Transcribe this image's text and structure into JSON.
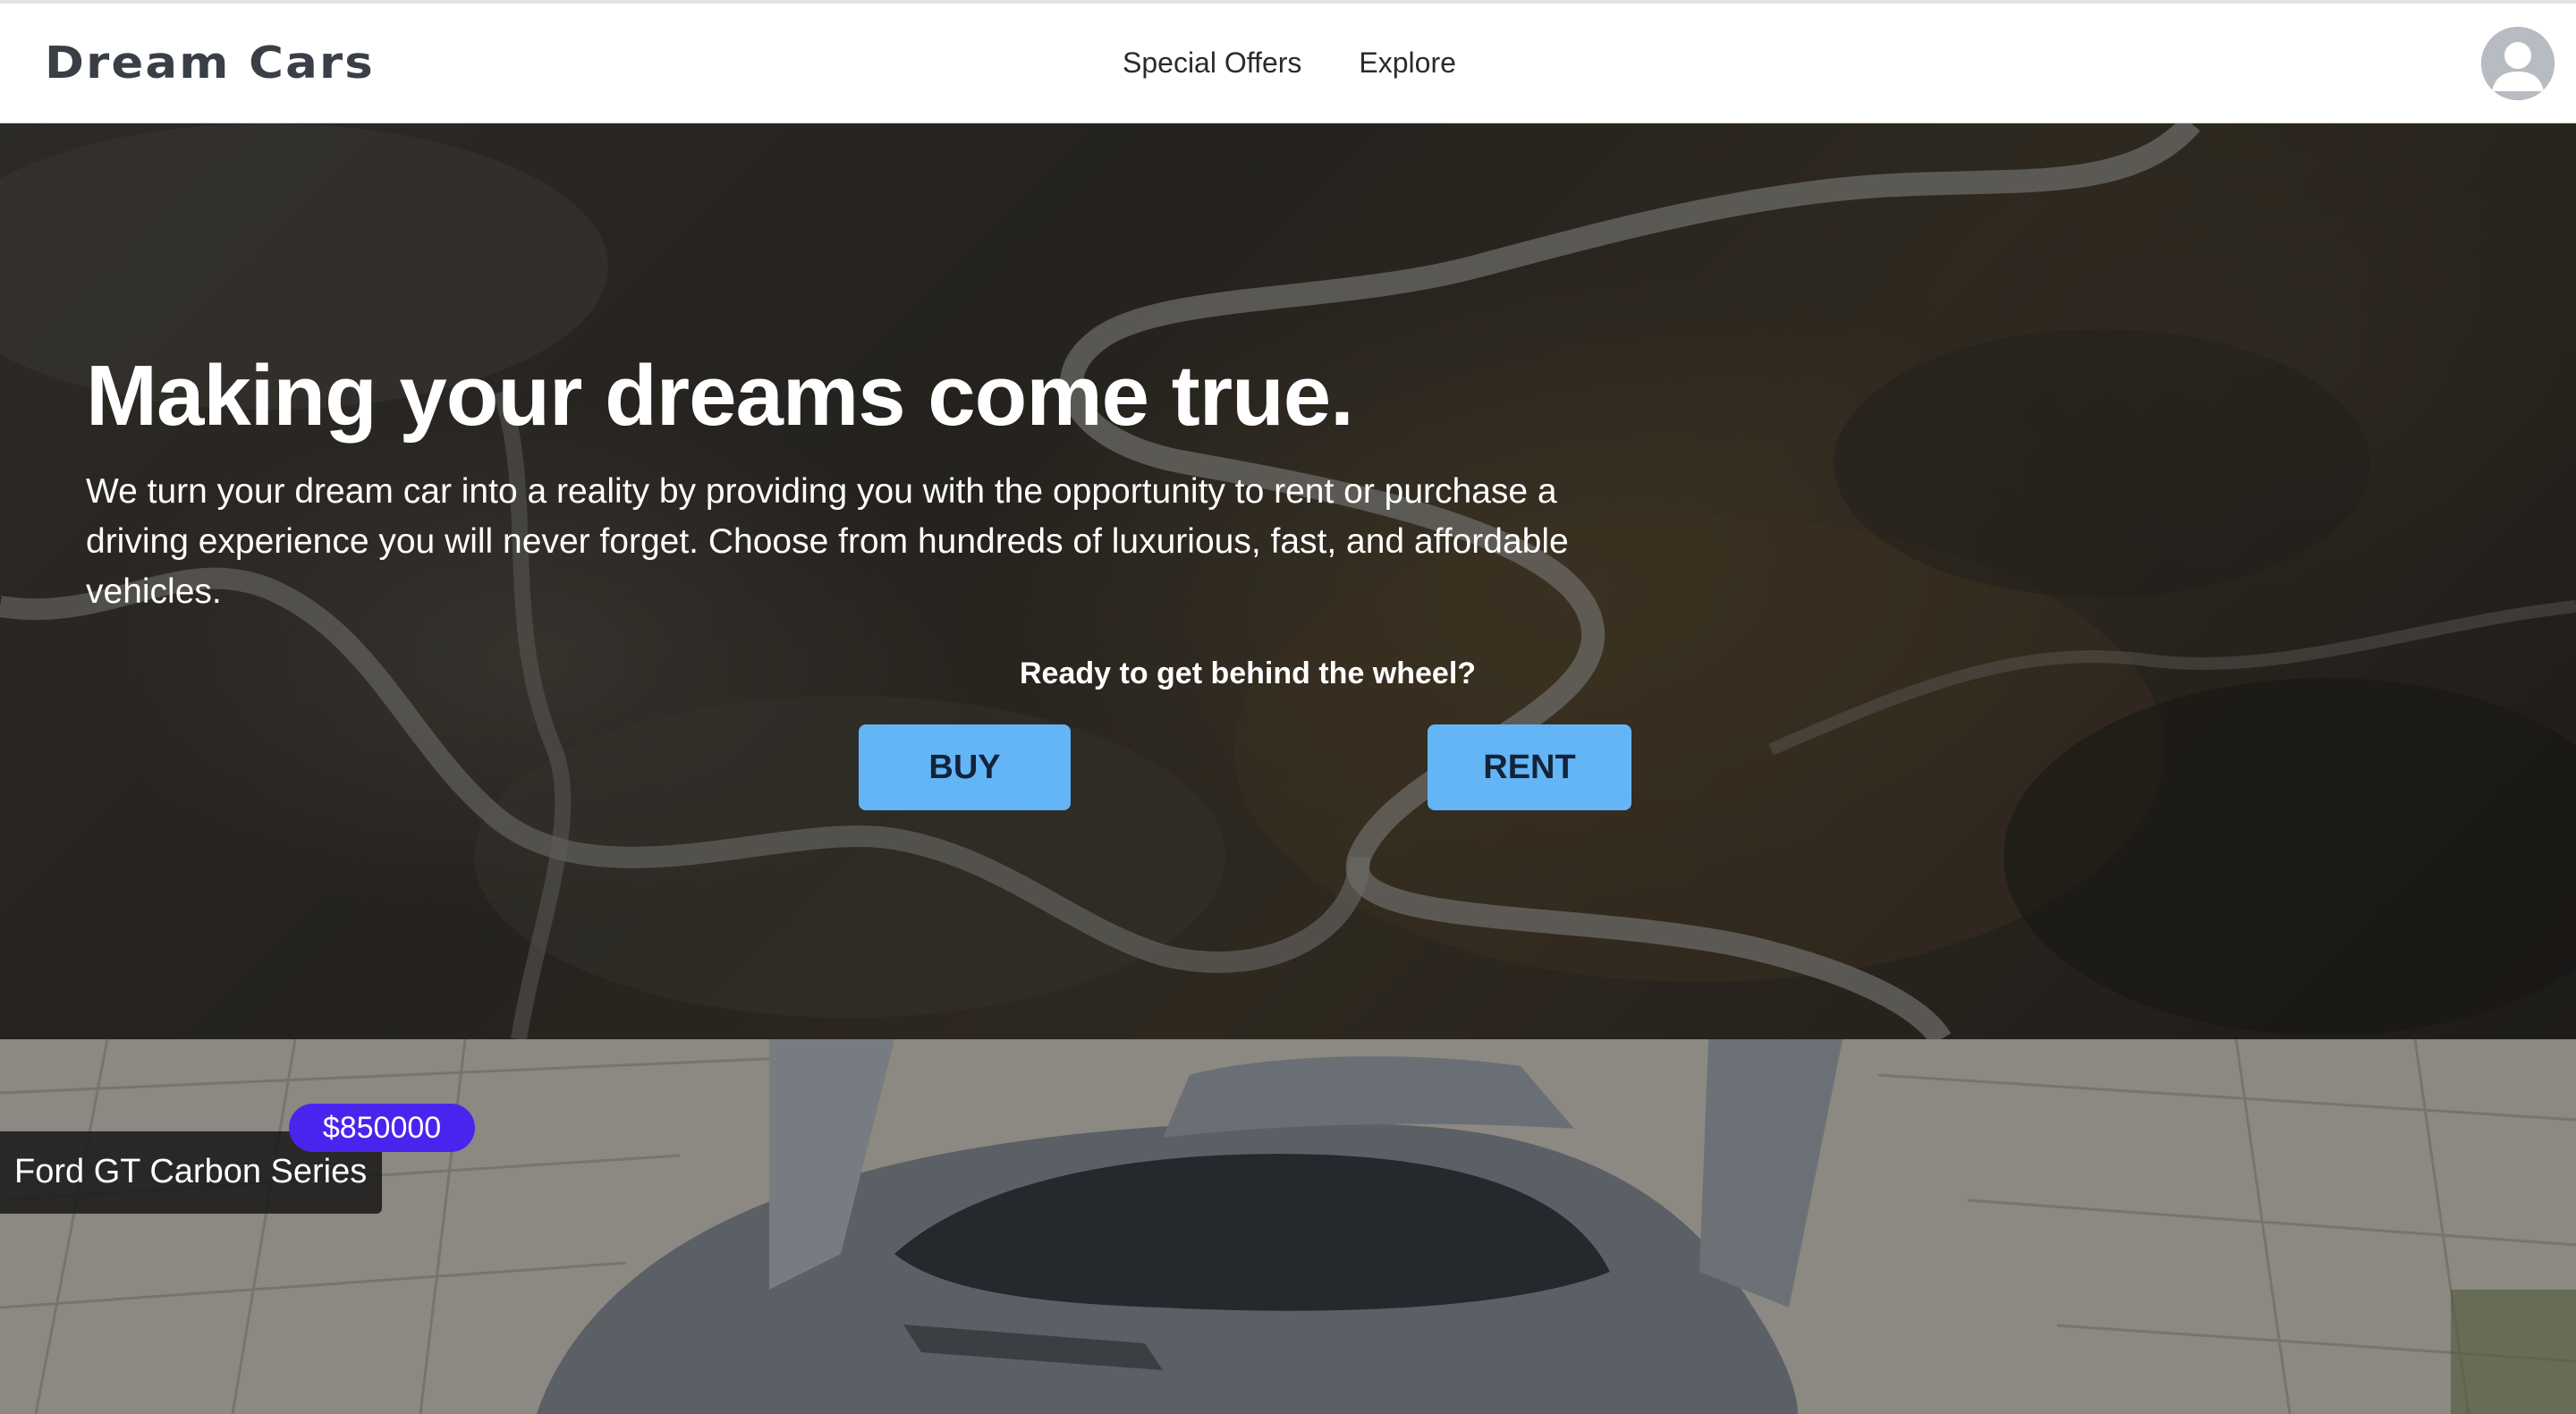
{
  "header": {
    "brand": "Dream Cars",
    "nav": [
      {
        "label": "Special Offers"
      },
      {
        "label": "Explore"
      }
    ],
    "avatar_icon": "user-avatar-icon"
  },
  "hero": {
    "title": "Making your dreams come true.",
    "description": "We turn your dream car into a reality by providing you with the opportunity to rent or purchase a driving experience you will never forget. Choose from hundreds of luxurious, fast, and affordable vehicles.",
    "cta_prompt": "Ready to get behind the wheel?",
    "buy_label": "BUY",
    "rent_label": "RENT",
    "button_color": "#64b5f6"
  },
  "featured": {
    "car_name": "Ford GT Carbon Series",
    "price": "$850000",
    "price_badge_color": "#4a24ee"
  }
}
